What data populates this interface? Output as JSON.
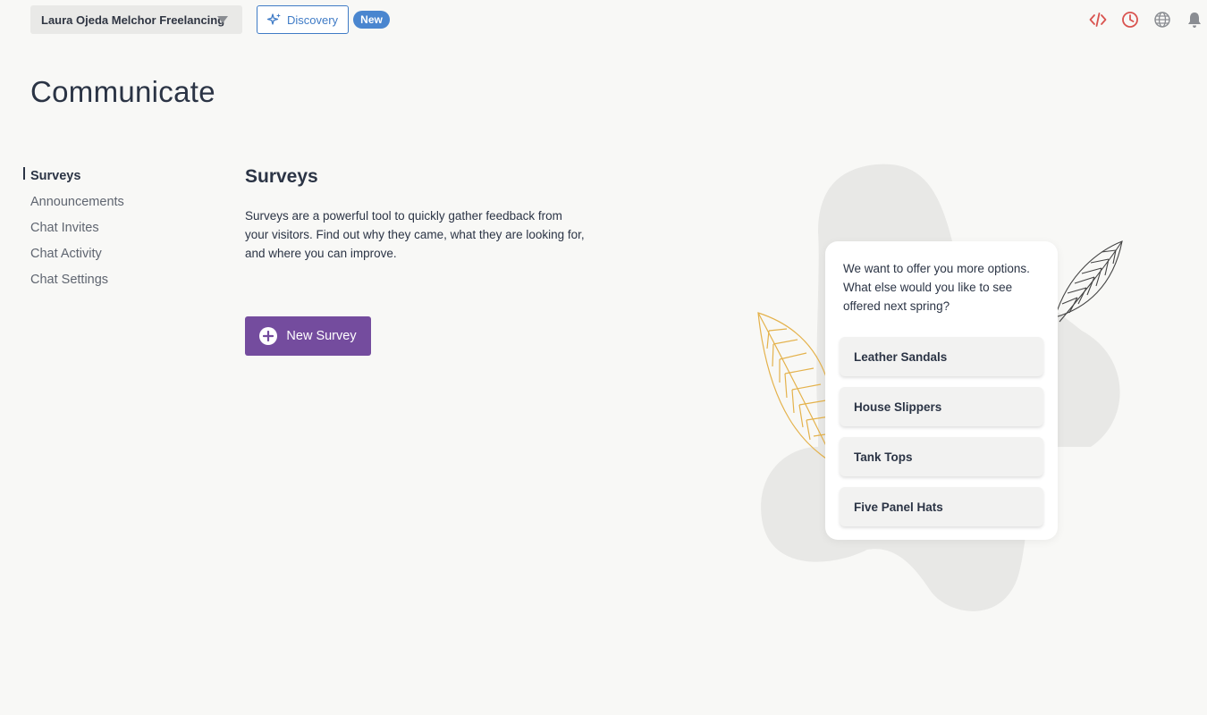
{
  "topbar": {
    "account_name": "Laura Ojeda Melchor Freelancing",
    "discovery_label": "Discovery",
    "new_badge": "New",
    "icons": [
      "code-icon",
      "clock-icon",
      "globe-icon",
      "bell-icon"
    ],
    "icon_colors": {
      "code": "#d9534f",
      "clock": "#d9534f",
      "globe": "#8a8d92",
      "bell": "#8a8d92"
    }
  },
  "page": {
    "title": "Communicate"
  },
  "sidebar": {
    "items": [
      {
        "label": "Surveys",
        "active": true
      },
      {
        "label": "Announcements"
      },
      {
        "label": "Chat Invites"
      },
      {
        "label": "Chat Activity"
      },
      {
        "label": "Chat Settings"
      }
    ]
  },
  "main": {
    "title": "Surveys",
    "description": "Surveys are a powerful tool to quickly gather feedback from your visitors. Find out why they came, what they are looking for, and where you can improve.",
    "new_survey_label": "New Survey",
    "accent": "#744c9e"
  },
  "preview": {
    "question": "We want to offer you more options. What else would you like to see offered next spring?",
    "options": [
      "Leather Sandals",
      "House Slippers",
      "Tank Tops",
      "Five Panel Hats"
    ]
  }
}
